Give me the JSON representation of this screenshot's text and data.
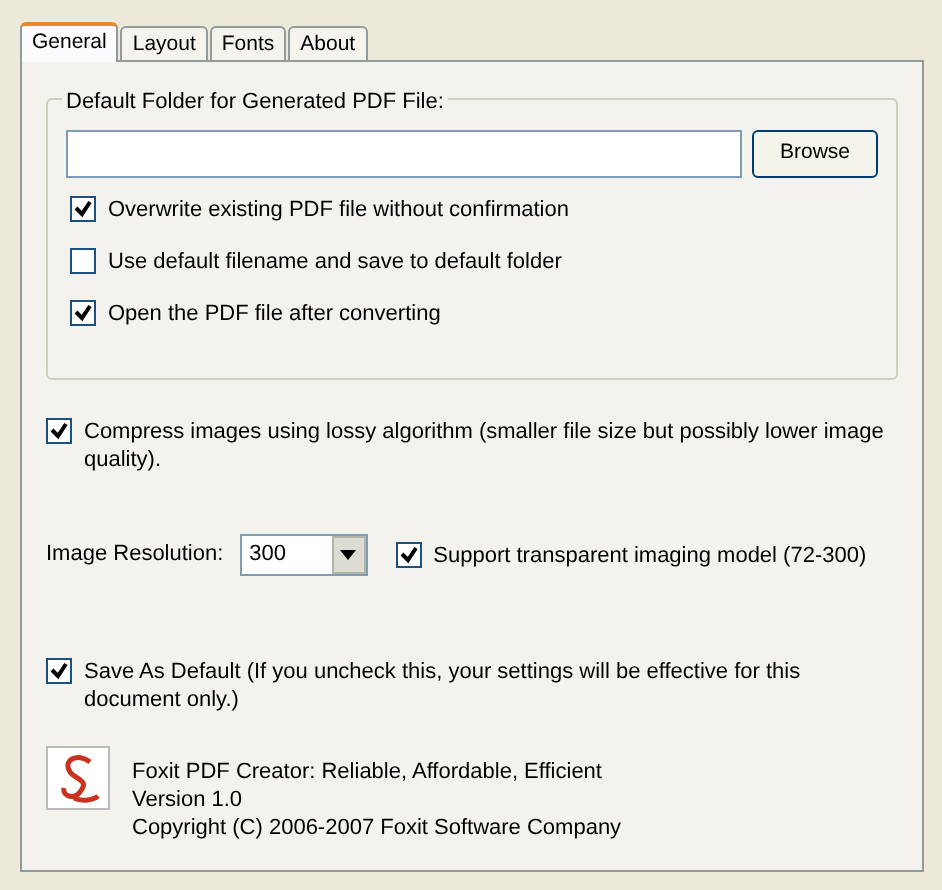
{
  "tabs": [
    {
      "label": "General",
      "selected": true
    },
    {
      "label": "Layout",
      "selected": false
    },
    {
      "label": "Fonts",
      "selected": false
    },
    {
      "label": "About",
      "selected": false
    }
  ],
  "folder_group": {
    "title": "Default Folder for Generated PDF File:",
    "browse_button": "Browse",
    "options": [
      {
        "label": "Overwrite existing PDF file without confirmation",
        "checked": true
      },
      {
        "label": "Use default filename and save to default folder",
        "checked": false
      },
      {
        "label": "Open the PDF file after converting",
        "checked": true
      }
    ]
  },
  "compress": {
    "label": "Compress images using lossy algorithm (smaller file size but possibly lower image quality).",
    "checked": true
  },
  "resolution": {
    "label": "Image Resolution:",
    "value": "300"
  },
  "transparent": {
    "label": "Support transparent imaging model (72-300)",
    "checked": true
  },
  "save_default": {
    "label": "Save As Default (If you uncheck this, your settings will be effective for this document only.)",
    "checked": true
  },
  "about": {
    "lines": [
      "Foxit PDF Creator: Reliable, Affordable, Efficient",
      "Version 1.0",
      "Copyright (C) 2006-2007 Foxit Software Company"
    ]
  }
}
